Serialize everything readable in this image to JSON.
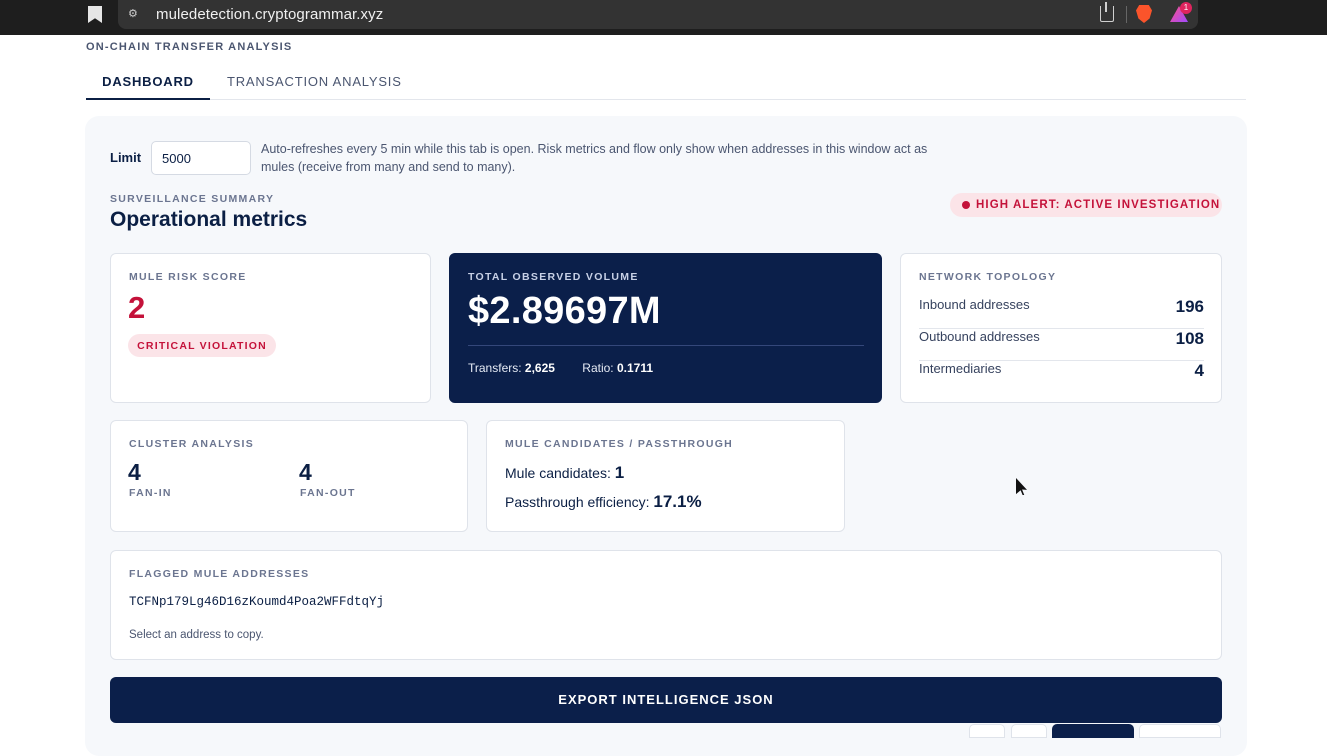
{
  "browser": {
    "url": "muledetection.cryptogrammar.xyz",
    "notification_count": "1"
  },
  "header": {
    "eyebrow": "ON-CHAIN TRANSFER ANALYSIS"
  },
  "tabs": [
    {
      "label": "DASHBOARD"
    },
    {
      "label": "TRANSACTION ANALYSIS"
    }
  ],
  "controls": {
    "limit_label": "Limit",
    "limit_value": "5000",
    "note": "Auto-refreshes every 5 min while this tab is open. Risk metrics and flow only show when addresses in this window act as mules (receive from many and send to many)."
  },
  "summary": {
    "eyebrow": "SURVEILLANCE SUMMARY",
    "title": "Operational metrics",
    "alert": "HIGH ALERT: ACTIVE INVESTIGATION"
  },
  "risk": {
    "label": "MULE RISK SCORE",
    "score": "2",
    "status": "CRITICAL VIOLATION"
  },
  "volume": {
    "label": "TOTAL OBSERVED VOLUME",
    "value": "$2.89697M",
    "transfers_label": "Transfers:",
    "transfers": "2,625",
    "ratio_label": "Ratio:",
    "ratio": "0.1711"
  },
  "topology": {
    "label": "NETWORK TOPOLOGY",
    "rows": [
      {
        "label": "Inbound addresses",
        "value": "196"
      },
      {
        "label": "Outbound addresses",
        "value": "108"
      },
      {
        "label": "Intermediaries",
        "value": "4"
      }
    ]
  },
  "cluster": {
    "label": "CLUSTER ANALYSIS",
    "fan_in": "4",
    "fan_in_label": "FAN-IN",
    "fan_out": "4",
    "fan_out_label": "FAN-OUT"
  },
  "mule": {
    "label": "MULE CANDIDATES / PASSTHROUGH",
    "candidates_label": "Mule candidates:",
    "candidates": "1",
    "efficiency_label": "Passthrough efficiency:",
    "efficiency": "17.1%"
  },
  "flagged": {
    "label": "FLAGGED MULE ADDRESSES",
    "address": "TCFNp179Lg46D16zKoumd4Poa2WFFdtqYj",
    "hint": "Select an address to copy."
  },
  "export_label": "EXPORT INTELLIGENCE JSON",
  "colors": {
    "navy": "#0b1f4a",
    "alert_red": "#c4123a",
    "alert_bg": "#fbe4e8",
    "panel_bg": "#f6f8fb"
  }
}
